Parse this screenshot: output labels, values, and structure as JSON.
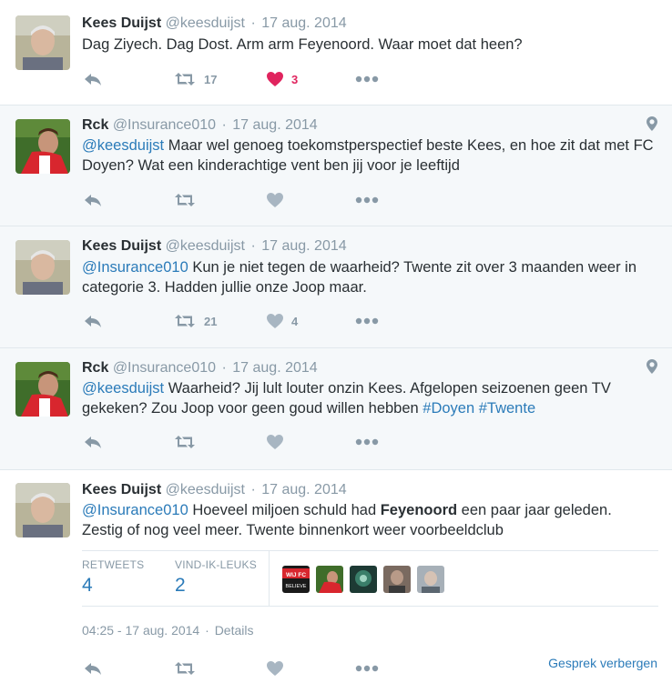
{
  "tweets": [
    {
      "name": "Kees Duijst",
      "handle": "@keesduijst",
      "time": "17 aug. 2014",
      "text": "Dag Ziyech. Dag Dost. Arm arm Feyenoord. Waar moet dat heen?",
      "retweets": "17",
      "likes": "3"
    },
    {
      "name": "Rck",
      "handle": "@Insurance010",
      "time": "17 aug. 2014",
      "mention": "@keesduijst",
      "text": " Maar wel genoeg toekomstperspectief beste Kees, en hoe zit dat met FC Doyen? Wat een kinderachtige vent ben jij voor je leeftijd"
    },
    {
      "name": "Kees Duijst",
      "handle": "@keesduijst",
      "time": "17 aug. 2014",
      "mention": "@Insurance010",
      "text": " Kun je niet tegen de waarheid? Twente zit over 3 maanden weer in categorie 3. Hadden jullie onze Joop maar.",
      "retweets": "21",
      "likes": "4"
    },
    {
      "name": "Rck",
      "handle": "@Insurance010",
      "time": "17 aug. 2014",
      "mention": "@keesduijst",
      "text": " Waarheid? Jij lult louter onzin Kees. Afgelopen seizoenen geen TV gekeken? Zou Joop voor geen goud willen hebben ",
      "hashtag1": "#Doyen",
      "hashtag2": "#Twente"
    },
    {
      "name": "Kees Duijst",
      "handle": "@keesduijst",
      "time": "17 aug. 2014",
      "mention": "@Insurance010",
      "text_a": " Hoeveel miljoen schuld had ",
      "text_bold": "Feyenoord",
      "text_b": " een paar jaar geleden. Zestig of nog veel meer. Twente binnenkort weer voorbeeldclub",
      "stats": {
        "retweets_label": "RETWEETS",
        "retweets_value": "4",
        "likes_label": "VIND-IK-LEUKS",
        "likes_value": "2"
      },
      "timestamp": "04:25 - 17 aug. 2014",
      "details": "Details",
      "hide_conversation": "Gesprek verbergen"
    }
  ],
  "separator": "·",
  "avatar_badge": {
    "line1": "WIJ  FC",
    "line2": "BELIEVE"
  },
  "colors": {
    "link": "#2b7bb9",
    "like_active": "#e0245e",
    "muted": "#8899a6",
    "grey_bg": "#f5f8fa"
  },
  "icons": [
    "reply-icon",
    "retweet-icon",
    "heart-icon",
    "more-icon",
    "location-pin-icon"
  ]
}
